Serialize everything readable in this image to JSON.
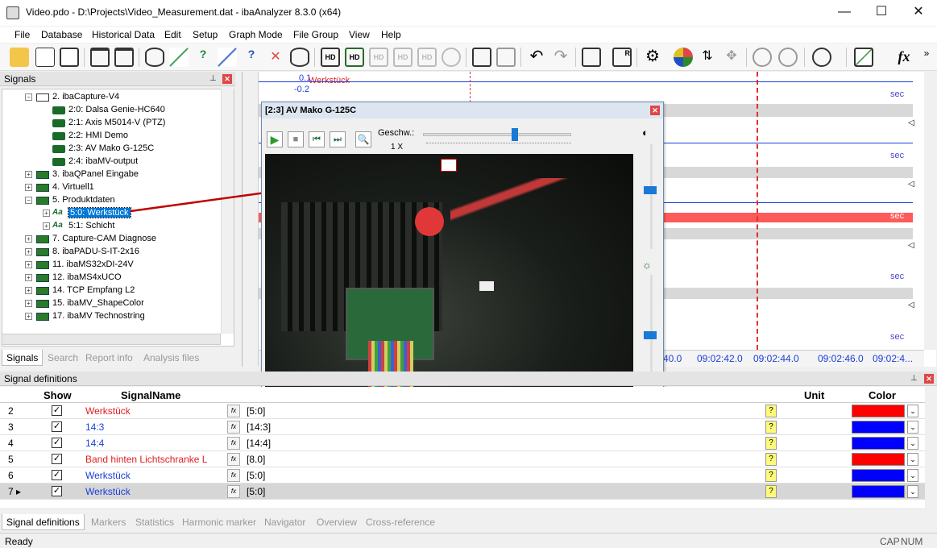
{
  "window": {
    "title": "Video.pdo - D:\\Projects\\Video_Measurement.dat - ibaAnalyzer 8.3.0 (x64)",
    "min": "—",
    "max": "☐",
    "close": "✕"
  },
  "menu": [
    "File",
    "Database",
    "Historical Data",
    "Edit",
    "Setup",
    "Graph Mode",
    "File Group",
    "View",
    "Help"
  ],
  "signals_panel": {
    "title": "Signals",
    "tree": [
      {
        "label": "2. ibaCapture-V4",
        "type": "camera-group",
        "indent": 0,
        "expanded": true
      },
      {
        "label": "2:0: Dalsa Genie-HC640",
        "type": "camera",
        "indent": 1
      },
      {
        "label": "2:1: Axis M5014-V (PTZ)",
        "type": "camera",
        "indent": 1
      },
      {
        "label": "2:2: HMI Demo",
        "type": "camera",
        "indent": 1
      },
      {
        "label": "2:3: AV Mako G-125C",
        "type": "camera",
        "indent": 1
      },
      {
        "label": "2:4: ibaMV-output",
        "type": "camera",
        "indent": 1
      },
      {
        "label": "3. ibaQPanel Eingabe",
        "type": "module",
        "indent": 0
      },
      {
        "label": "4. Virtuell1",
        "type": "module",
        "indent": 0
      },
      {
        "label": "5. Produktdaten",
        "type": "module",
        "indent": 0,
        "expanded": true
      },
      {
        "label": "5:0: Werkstück",
        "type": "text",
        "indent": 1,
        "selected": true
      },
      {
        "label": "5:1: Schicht",
        "type": "text",
        "indent": 1
      },
      {
        "label": "7. Capture-CAM Diagnose",
        "type": "module",
        "indent": 0
      },
      {
        "label": "8. ibaPADU-S-IT-2x16",
        "type": "module",
        "indent": 0
      },
      {
        "label": "11. ibaMS32xDI-24V",
        "type": "module",
        "indent": 0
      },
      {
        "label": "12. ibaMS4xUCO",
        "type": "module",
        "indent": 0
      },
      {
        "label": "14. TCP Empfang L2",
        "type": "module",
        "indent": 0
      },
      {
        "label": "15. ibaMV_ShapeColor",
        "type": "module",
        "indent": 0
      },
      {
        "label": "17. ibaMV Technostring",
        "type": "module",
        "indent": 0
      }
    ],
    "tabs": [
      "Signals",
      "Search",
      "Report info",
      "Analysis files"
    ]
  },
  "graph": {
    "ticks": [
      "0.1",
      "-0.2"
    ],
    "signal_label": "Werkstück",
    "time_labels": [
      "40.0",
      "09:02:42.0",
      "09:02:44.0",
      "09:02:46.0",
      "09:02:4..."
    ],
    "sec_label": "sec"
  },
  "video_dialog": {
    "title": "[2:3] AV Mako G-125C",
    "speed_label": "Geschw.:",
    "speed_value": "1 X"
  },
  "signal_definitions": {
    "title": "Signal definitions",
    "columns": {
      "show": "Show",
      "name": "SignalName",
      "unit": "Unit",
      "color": "Color"
    },
    "rows": [
      {
        "num": "2",
        "name": "Werkstück",
        "expr": "[5:0]",
        "name_color": "#e02020",
        "color": "#ff0000"
      },
      {
        "num": "3",
        "name": "14:3",
        "expr": "[14:3]",
        "name_color": "#1a3fd9",
        "color": "#0000ff"
      },
      {
        "num": "4",
        "name": "14:4",
        "expr": "[14:4]",
        "name_color": "#1a3fd9",
        "color": "#0000ff"
      },
      {
        "num": "5",
        "name": "Band hinten Lichtschranke L",
        "expr": "[8.0]",
        "name_color": "#e02020",
        "color": "#ff0000"
      },
      {
        "num": "6",
        "name": "Werkstück",
        "expr": "[5:0]",
        "name_color": "#1a3fd9",
        "color": "#0000ff"
      },
      {
        "num": "7 ▸",
        "name": "Werkstück",
        "expr": "[5:0]",
        "name_color": "#1a3fd9",
        "color": "#0000ff",
        "selected": true
      }
    ],
    "tabs": [
      "Signal definitions",
      "Markers",
      "Statistics",
      "Harmonic marker",
      "Navigator",
      "Overview",
      "Cross-reference"
    ]
  },
  "status": {
    "text": "Ready",
    "cap": "CAP",
    "num": "NUM"
  }
}
